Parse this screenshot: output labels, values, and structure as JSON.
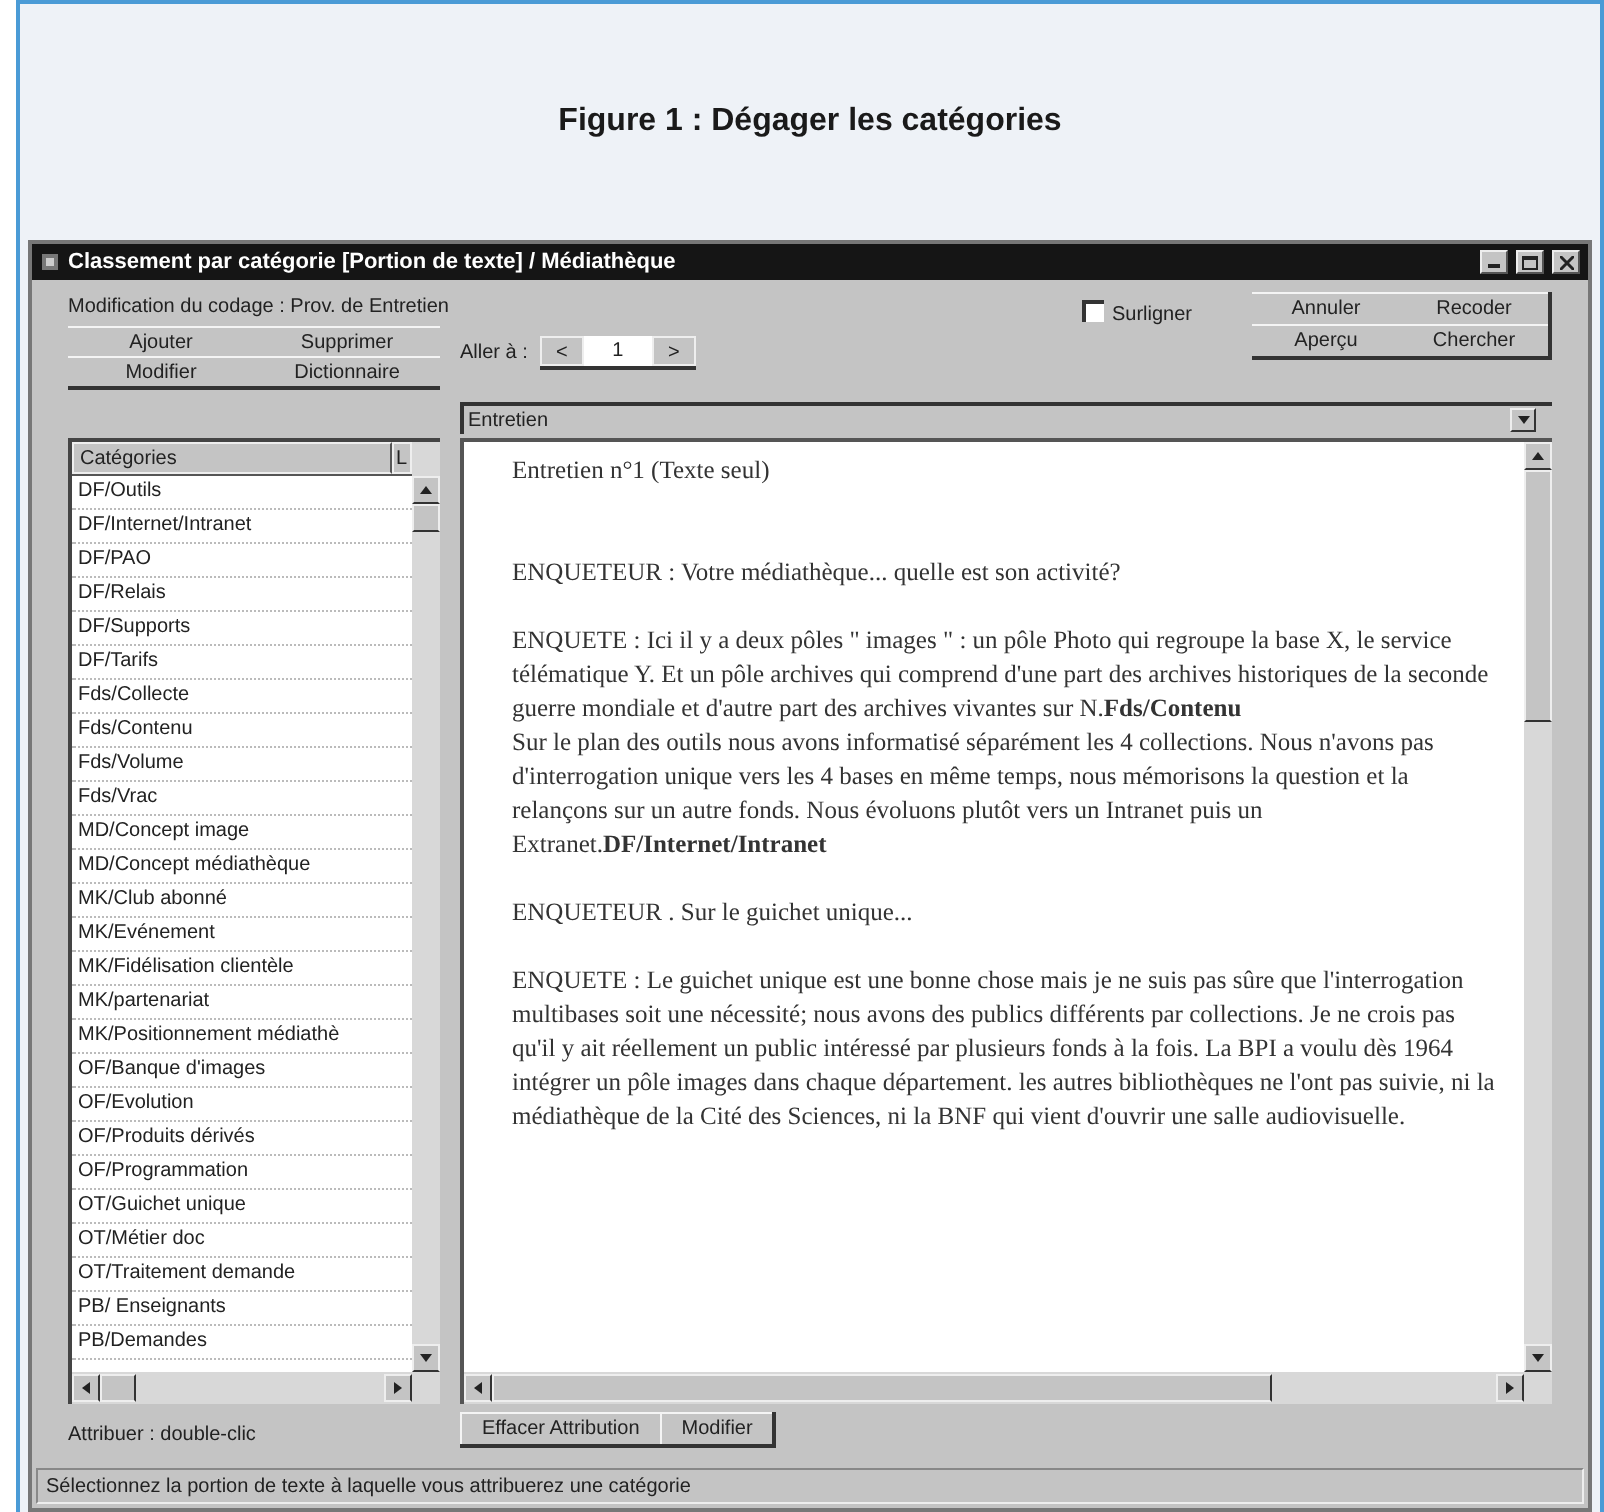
{
  "figure": {
    "caption": "Figure 1 : Dégager les catégories"
  },
  "window": {
    "title": "Classement par catégorie [Portion de texte] / Médiathèque"
  },
  "subtitle": "Modification du codage : Prov. de Entretien",
  "left_buttons": [
    "Ajouter",
    "Supprimer",
    "Modifier",
    "Dictionnaire"
  ],
  "nav": {
    "label": "Aller à :",
    "prev": "<",
    "page": "1",
    "next": ">"
  },
  "highlight_checkbox": {
    "label": "Surligner",
    "checked": false
  },
  "right_buttons": [
    "Annuler",
    "Recoder",
    "Aperçu",
    "Chercher"
  ],
  "document_select": {
    "value": "Entretien"
  },
  "categories": {
    "columns": [
      "Catégories",
      "L"
    ],
    "rows": [
      "DF/Outils",
      "DF/Internet/Intranet",
      "DF/PAO",
      "DF/Relais",
      "DF/Supports",
      "DF/Tarifs",
      "Fds/Collecte",
      "Fds/Contenu",
      "Fds/Volume",
      "Fds/Vrac",
      "MD/Concept image",
      "MD/Concept médiathèque",
      "MK/Club abonné",
      "MK/Evénement",
      "MK/Fidélisation clientèle",
      "MK/partenariat",
      "MK/Positionnement médiathè",
      "OF/Banque d'images",
      "OF/Evolution",
      "OF/Produits dérivés",
      "OF/Programmation",
      "OT/Guichet unique",
      "OT/Métier doc",
      "OT/Traitement demande",
      "PB/ Enseignants",
      "PB/Demandes"
    ]
  },
  "text": {
    "paragraphs": [
      {
        "kind": "heading",
        "text": "Entretien n°1 (Texte seul)"
      },
      {
        "kind": "para",
        "text": "ENQUETEUR :  Votre médiathèque... quelle est son activité?"
      },
      {
        "kind": "para",
        "text": "ENQUETE : Ici il y a deux pôles \" images \" : un pôle Photo qui regroupe la base X, le service télématique Y. Et un pôle archives qui comprend d'une part des archives historiques de la seconde guerre mondiale et d'autre part des archives vivantes sur N.**Fds/Contenu**"
      },
      {
        "kind": "continuation",
        "text": "Sur le plan des outils nous avons informatisé séparément les 4 collections. Nous n'avons pas d'interrogation unique vers les 4 bases en même temps, nous mémorisons la question et la relançons sur un autre fonds. Nous évoluons plutôt vers un Intranet puis un Extranet.**DF/Internet/Intranet**"
      },
      {
        "kind": "para",
        "text": "ENQUETEUR . Sur le guichet unique..."
      },
      {
        "kind": "para",
        "text": "ENQUETE : Le guichet unique est une bonne chose mais je ne suis pas sûre que l'interrogation multibases soit une nécessité; nous avons des publics différents par collections. Je ne crois pas qu'il y ait réellement un public intéressé par plusieurs fonds à la fois. La BPI a voulu dès 1964 intégrer un pôle images dans chaque département. les autres bibliothèques ne l'ont pas suivie, ni la médiathèque de la Cité des Sciences, ni la BNF qui vient d'ouvrir une salle audiovisuelle."
      }
    ]
  },
  "attribute_hint": "Attribuer : double-clic",
  "bottom_buttons": [
    "Effacer Attribution",
    "Modifier"
  ],
  "status_bar": "Sélectionnez la portion de texte à laquelle vous attribuerez une catégorie"
}
